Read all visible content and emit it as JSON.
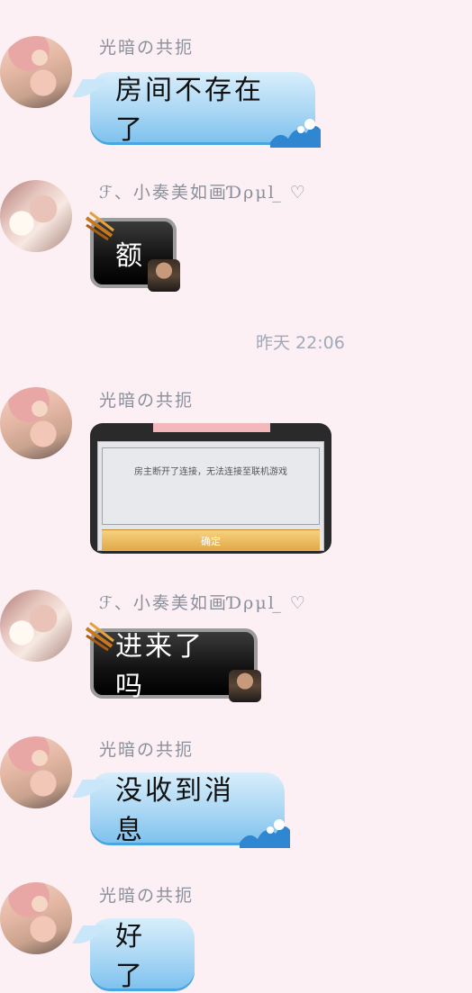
{
  "messages": [
    {
      "sender": "光暗の共扼",
      "text": "房间不存在了"
    },
    {
      "sender": "ℱ、小奏美如画Ɗρμl ̲ ♡",
      "text": "额"
    },
    {
      "sender": "光暗の共扼",
      "image_text": "房主断开了连接，无法连接至联机游戏",
      "image_button": "确定"
    },
    {
      "sender": "ℱ、小奏美如画Ɗρμl ̲ ♡",
      "text": "进来了吗"
    },
    {
      "sender": "光暗の共扼",
      "text": "没收到消息"
    },
    {
      "sender": "光暗の共扼",
      "text": "好了"
    }
  ],
  "timestamp": "昨天 22:06",
  "icons": [
    "avatar-girl",
    "avatar-angel",
    "claw-icon",
    "wave-icon",
    "character-face-icon"
  ]
}
